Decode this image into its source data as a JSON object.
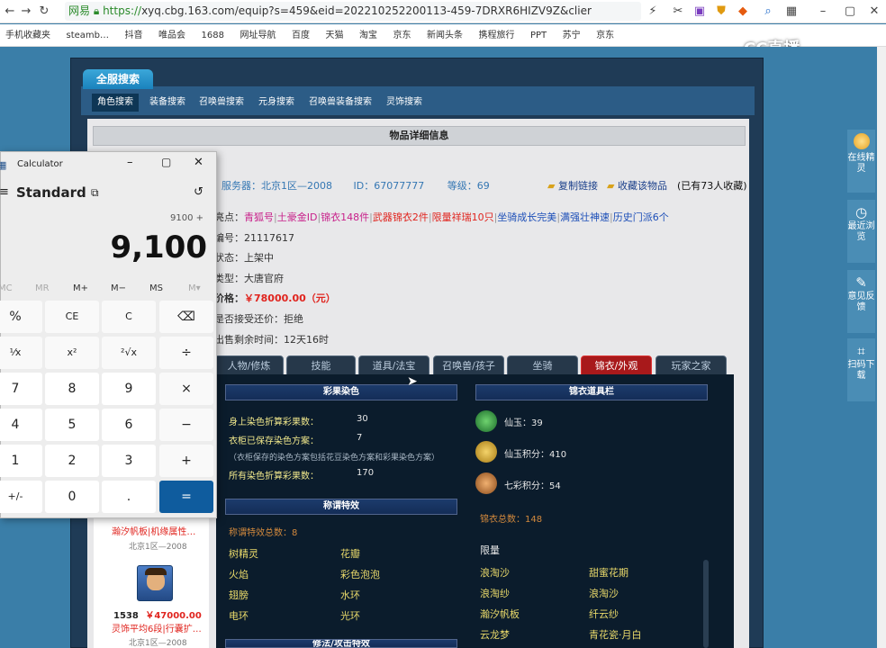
{
  "browser": {
    "brand": "网易",
    "url_https": "https://",
    "url_rest": "xyq.cbg.163.com/equip?s=459&eid=202210252200113-459-7DRXR6HIZV9Z&clier",
    "bookmarks": [
      "手机收藏夹",
      "steamb…",
      "抖音",
      "唯品会",
      "1688",
      "网址导航",
      "百度",
      "天猫",
      "淘宝",
      "京东",
      "新闻头条",
      "携程旅行",
      "PPT",
      "苏宁",
      "京东",
      "…"
    ],
    "watermark": "CC直播"
  },
  "nav": {
    "all_search": "全服搜索",
    "tabs": [
      "角色搜索",
      "装备搜索",
      "召唤兽搜索",
      "元身搜索",
      "召唤兽装备搜索",
      "灵饰搜索"
    ]
  },
  "detail": {
    "title": "物品详细信息",
    "server_label": "服务器：北京1区—2008",
    "id_label": "ID：67077777",
    "level_label": "等级：69",
    "copy_link": "复制链接",
    "fav": "收藏该物品",
    "fav_count": "(已有73人收藏)",
    "highlights_label": "亮点：",
    "highlights": [
      "青狐号",
      "土豪金ID",
      "锦衣148件",
      "武器锦衣2件",
      "限量祥瑞10只",
      "坐骑成长完美",
      "满强壮神速",
      "历史门派6个"
    ],
    "code_label": "编号：",
    "code": "21117617",
    "status_label": "状态：",
    "status": "上架中",
    "type_label": "类型：",
    "type": "大唐官府",
    "price_label": "价格：",
    "price": "￥78000.00（元）",
    "bargain_label": "是否接受还价：",
    "bargain": "拒绝",
    "remain_label": "出售剩余时间：",
    "remain": "12天16时"
  },
  "subtabs": [
    "人物/修炼",
    "技能",
    "道具/法宝",
    "召唤兽/孩子",
    "坐骑",
    "锦衣/外观",
    "玩家之家"
  ],
  "panel": {
    "color_title": "彩果染色",
    "color_rows": [
      {
        "label": "身上染色折算彩果数：",
        "value": "30"
      },
      {
        "label": "衣柜已保存染色方案：",
        "value": "7"
      },
      {
        "label": "所有染色折算彩果数：",
        "value": "170"
      }
    ],
    "color_note": "（衣柜保存的染色方案包括花豆染色方案和彩果染色方案）",
    "title_title": "称谓特效",
    "title_count": "称谓特效总数：8",
    "titles": [
      "树精灵",
      "花瓣",
      "火焰",
      "彩色泡泡",
      "翅膀",
      "水环",
      "电环",
      "光环"
    ],
    "bottom_title": "修法/攻击特效",
    "jinyi_title": "锦衣道具栏",
    "jinyi": [
      {
        "label": "仙玉：",
        "value": "39"
      },
      {
        "label": "仙玉积分：",
        "value": "410"
      },
      {
        "label": "七彩积分：",
        "value": "54"
      }
    ],
    "jinyi_total": "锦衣总数：148",
    "limited_label": "限量",
    "limited": [
      "浪淘沙",
      "甜蜜花期",
      "浪淘纱",
      "浪淘沙",
      "瀚汐帆板",
      "纤云纱",
      "云龙梦",
      "青花瓷·月白"
    ]
  },
  "leftcol": {
    "item1_desc": "瀚汐帆板|机缘属性…",
    "item1_server": "北京1区—2008",
    "item2_level": "1538",
    "item2_price": "￥47000.00",
    "item2_desc": "灵饰平均6段|行囊扩…",
    "item2_server": "北京1区—2008"
  },
  "calculator": {
    "title": "Calculator",
    "mode": "Standard",
    "expression": "9100 +",
    "display": "9,100",
    "memory": [
      "MC",
      "MR",
      "M+",
      "M−",
      "MS",
      "M▾"
    ],
    "keys": [
      "%",
      "CE",
      "C",
      "⌫",
      "¹⁄x",
      "x²",
      "²√x",
      "÷",
      "7",
      "8",
      "9",
      "×",
      "4",
      "5",
      "6",
      "−",
      "1",
      "2",
      "3",
      "+",
      "+/-",
      "0",
      ".",
      "="
    ]
  },
  "rightbar": {
    "online": "在线精灵",
    "recent": "最近浏览",
    "feedback": "意见反馈",
    "scan": "扫码下载"
  },
  "colors": {
    "price_red": "#e0241e",
    "accent_blue": "#0f5c9e",
    "active_tab_red": "#a8191b"
  }
}
